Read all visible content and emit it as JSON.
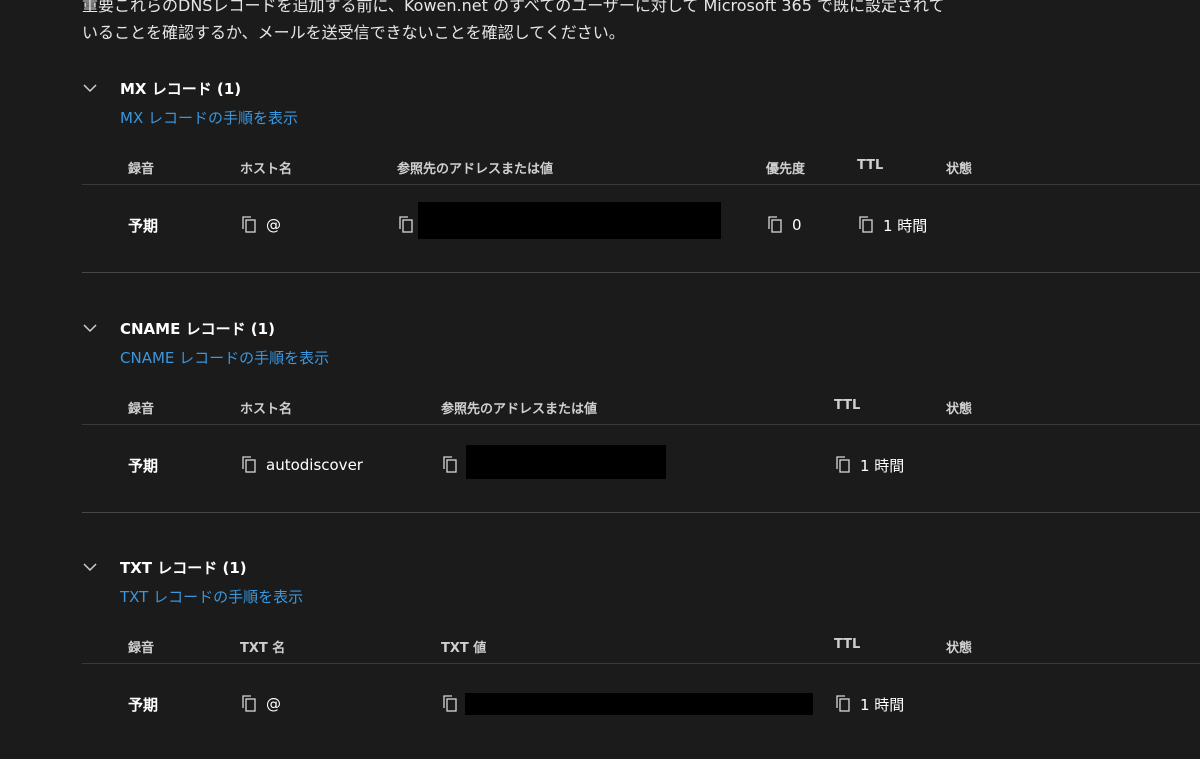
{
  "intro": {
    "line1": "重要これらのDNSレコードを追加する前に、Kowen.net のすべてのユーザーに対して Microsoft 365 で既に設定されて",
    "line2": "いることを確認するか、メールを送受信できないことを確認してください。"
  },
  "mx": {
    "title": "MX レコード (1)",
    "link": "MX レコードの手順を表示",
    "headers": {
      "record": "録音",
      "host": "ホスト名",
      "value": "参照先のアドレスまたは値",
      "priority": "優先度",
      "ttl": "TTL",
      "status": "状態"
    },
    "row": {
      "record": "予期",
      "host": "@",
      "priority": "0",
      "ttl": "1 時間"
    }
  },
  "cname": {
    "title": "CNAME レコード (1)",
    "link": "CNAME レコードの手順を表示",
    "headers": {
      "record": "録音",
      "host": "ホスト名",
      "value": "参照先のアドレスまたは値",
      "ttl": "TTL",
      "status": "状態"
    },
    "row": {
      "record": "予期",
      "host": "autodiscover",
      "ttl": "1 時間"
    }
  },
  "txt": {
    "title": "TXT レコード (1)",
    "link": "TXT レコードの手順を表示",
    "headers": {
      "record": "録音",
      "name": "TXT 名",
      "value": "TXT 値",
      "ttl": "TTL",
      "status": "状態"
    },
    "row": {
      "record": "予期",
      "name": "@",
      "ttl": "1 時間"
    }
  },
  "icons": {
    "chevron": "chevron-down-icon",
    "copy": "copy-icon"
  },
  "colors": {
    "background": "#1b1b1b",
    "link": "#3a96dd",
    "divider": "#3a3a3a",
    "redaction": "#000000"
  }
}
